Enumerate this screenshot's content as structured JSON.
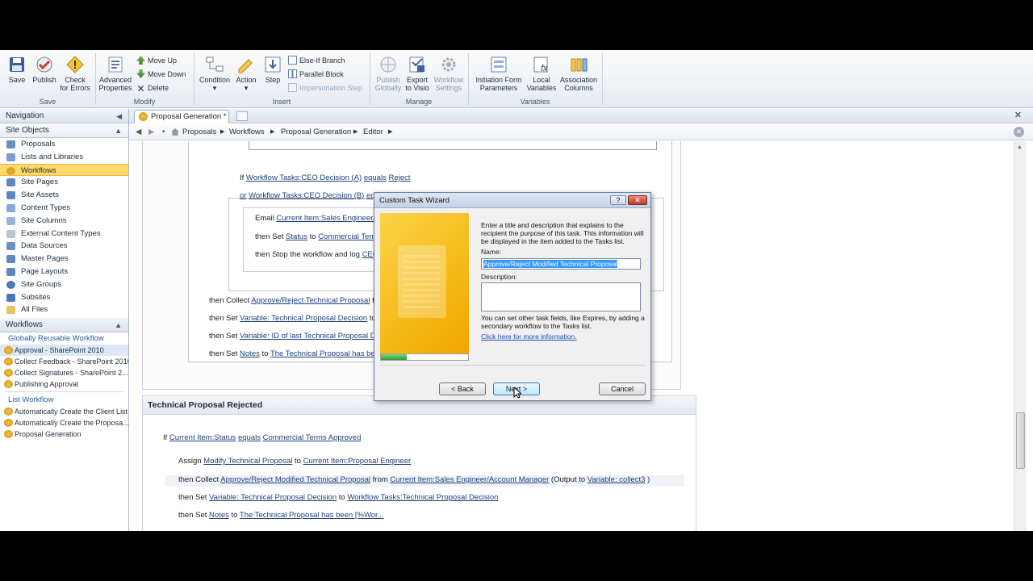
{
  "ribbon": {
    "save": "Save",
    "publish": "Publish",
    "check_errors_1": "Check",
    "check_errors_2": "for Errors",
    "advanced_1": "Advanced",
    "advanced_2": "Properties",
    "move_up": "Move Up",
    "move_down": "Move Down",
    "delete": "Delete",
    "condition": "Condition",
    "action": "Action",
    "step": "Step",
    "else_if": "Else-If Branch",
    "parallel": "Parallel Block",
    "impersonation": "Impersonation Step",
    "publish_globally_1": "Publish",
    "publish_globally_2": "Globally",
    "export_visio_1": "Export",
    "export_visio_2": "to Visio",
    "workflow_settings_1": "Workflow",
    "workflow_settings_2": "Settings",
    "init_form_1": "Initiation Form",
    "init_form_2": "Parameters",
    "local_vars_1": "Local",
    "local_vars_2": "Variables",
    "assoc_cols_1": "Association",
    "assoc_cols_2": "Columns",
    "groups": {
      "save": "Save",
      "modify": "Modify",
      "insert": "Insert",
      "manage": "Manage",
      "variables": "Variables"
    }
  },
  "nav": {
    "header": "Navigation",
    "site_objects": "Site Objects",
    "items": [
      "Proposals",
      "Lists and Libraries",
      "Workflows",
      "Site Pages",
      "Site Assets",
      "Content Types",
      "Site Columns",
      "External Content Types",
      "Data Sources",
      "Master Pages",
      "Page Layouts",
      "Site Groups",
      "Subsites",
      "All Files"
    ],
    "workflows_header": "Workflows",
    "globally_reusable": "Globally Reusable Workflow",
    "global_items": [
      "Approval - SharePoint 2010",
      "Collect Feedback - SharePoint 2010",
      "Collect Signatures - SharePoint 2...",
      "Publishing Approval"
    ],
    "list_workflow": "List Workflow",
    "list_items": [
      "Automatically Create the Client List",
      "Automatically Create the Proposa...",
      "Proposal Generation"
    ]
  },
  "tab": {
    "label": "Proposal Generation *"
  },
  "breadcrumb": [
    "Proposals",
    "Workflows",
    "Proposal Generation",
    "Editor"
  ],
  "editor": {
    "if_kw": "If",
    "cond1": "Workflow Tasks:CEO Decision (A)",
    "equals": "equals",
    "reject": "Reject",
    "or_kw": "or",
    "cond2": "Workflow Tasks:CEO Decision (B)",
    "eq_trunc": "eq",
    "email": "Email",
    "email_target": "Current Item:Sales Engineer/A",
    "then_set": "then Set",
    "status": "Status",
    "to": "to",
    "commercial_trunc": "Commercial Term",
    "stop_text": "then Stop the workflow and log",
    "stop_trunc": "CEO",
    "then_collect": "then Collect",
    "collect1": "Approve/Reject Technical Proposal",
    "collect1_trunc": "fr",
    "var1": "Variable: Technical Proposal Decision",
    "to_trunc": "to",
    "var2": "Variable: ID of last Technical Proposal De",
    "notes": "Notes",
    "notes_val_trunc": "The Technical Proposal has bee",
    "section2_title": "Technical Proposal Rejected",
    "s2_if_field": "Current Item:Status",
    "s2_if_val": "Commercial Terms Approved",
    "assign": "Assign",
    "assign_task": "Modify Technical Proposal",
    "assign_to": "Current Item:Proposal Engineer",
    "collect2": "Approve/Reject Modified Technical Proposal",
    "from": "from",
    "collect2_from": "Current Item:Sales Engineer/Account Manager",
    "output": "(Output to",
    "output_var": "Variable: collect3",
    "close_paren": ")",
    "s2_var1": "Variable: Technical Proposal Decision",
    "s2_var1_to": "Workflow Tasks:Technical Proposal Decision",
    "s2_notes_val": "The Technical Proposal has been [%Wor..."
  },
  "dialog": {
    "title": "Custom Task Wizard",
    "intro": "Enter a title and description that explains to the recipient the purpose of this task. This information will be displayed in the item added to the Tasks list.",
    "name_label": "Name:",
    "name_value": "Approve/Reject Modified Technical Proposal",
    "desc_label": "Description:",
    "note": "You can set other task fields, like Expires, by adding a secondary workflow to the Tasks list.",
    "link": "Click here for more information.",
    "back": "< Back",
    "next": "Next >",
    "cancel": "Cancel",
    "progress": 0.3
  }
}
